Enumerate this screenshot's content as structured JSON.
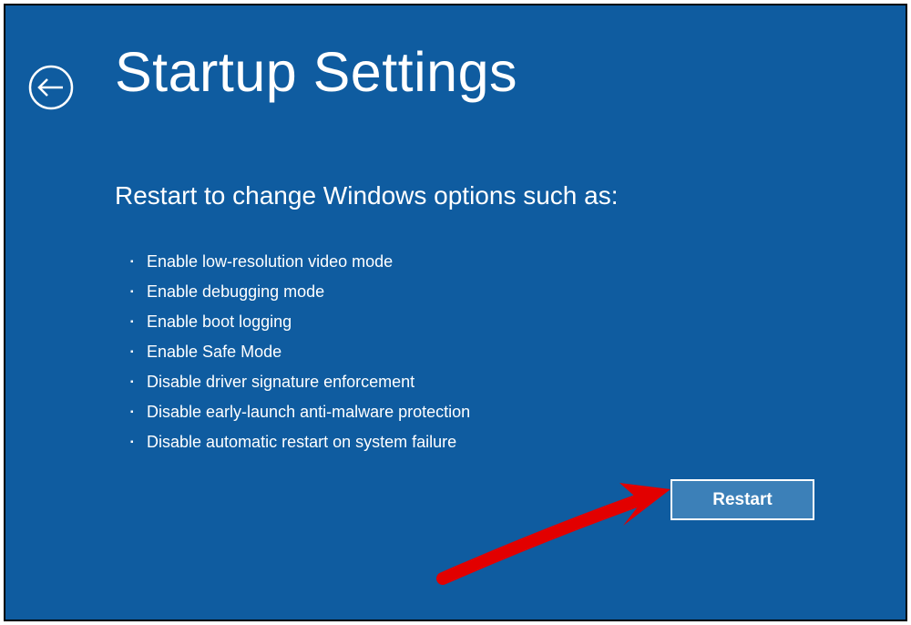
{
  "title": "Startup Settings",
  "subheading": "Restart to change Windows options such as:",
  "options": [
    "Enable low-resolution video mode",
    "Enable debugging mode",
    "Enable boot logging",
    "Enable Safe Mode",
    "Disable driver signature enforcement",
    "Disable early-launch anti-malware protection",
    "Disable automatic restart on system failure"
  ],
  "restart_label": "Restart",
  "colors": {
    "background": "#0f5ca0",
    "button_bg": "#3c80b8",
    "text": "#ffffff",
    "annotation": "#e20000"
  }
}
